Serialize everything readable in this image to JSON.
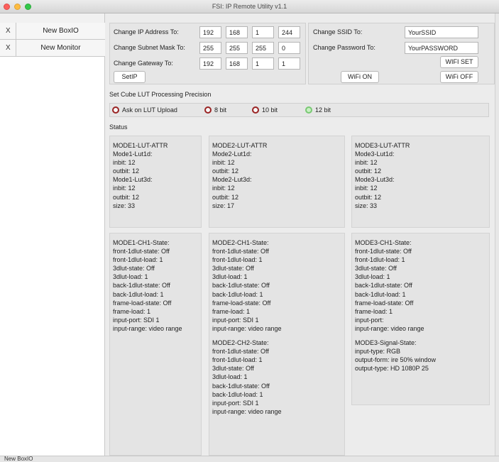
{
  "window": {
    "title": "FSI: IP Remote Utility v1.1"
  },
  "sidebar": {
    "items": [
      {
        "close": "X",
        "label": "New BoxIO"
      },
      {
        "close": "X",
        "label": "New Monitor"
      }
    ]
  },
  "network": {
    "ip_label": "Change IP Address To:",
    "ip": [
      "192",
      "168",
      "1",
      "244"
    ],
    "subnet_label": "Change Subnet Mask To:",
    "subnet": [
      "255",
      "255",
      "255",
      "0"
    ],
    "gateway_label": "Change Gateway To:",
    "gateway": [
      "192",
      "168",
      "1",
      "1"
    ],
    "setip_button": "SetIP"
  },
  "wifi": {
    "ssid_label": "Change SSID To:",
    "ssid_value": "YourSSID",
    "password_label": "Change Password To:",
    "password_value": "YourPASSWORD",
    "set_button": "WIFI SET",
    "on_button": "WiFi ON",
    "off_button": "WiFi OFF"
  },
  "lut_precision": {
    "heading": "Set Cube LUT Processing Precision",
    "options": [
      {
        "label": "Ask on LUT Upload",
        "selected": false
      },
      {
        "label": "8 bit",
        "selected": false
      },
      {
        "label": "10 bit",
        "selected": false
      },
      {
        "label": "12 bit",
        "selected": true
      }
    ]
  },
  "status": {
    "heading": "Status",
    "lut_attr": [
      [
        "MODE1-LUT-ATTR",
        "Mode1-Lut1d:",
        "inbit: 12",
        "outbit: 12",
        "Mode1-Lut3d:",
        "inbit: 12",
        "outbit: 12",
        "size: 33"
      ],
      [
        "MODE2-LUT-ATTR",
        "Mode2-Lut1d:",
        "inbit: 12",
        "outbit: 12",
        "Mode2-Lut3d:",
        "inbit: 12",
        "outbit: 12",
        "size: 17"
      ],
      [
        "MODE3-LUT-ATTR",
        "Mode3-Lut1d:",
        "inbit: 12",
        "outbit: 12",
        "Mode3-Lut3d:",
        "inbit: 12",
        "outbit: 12",
        "size: 33"
      ]
    ],
    "mode1_ch1": [
      "MODE1-CH1-State:",
      "front-1dlut-state: Off",
      "front-1dlut-load: 1",
      "3dlut-state: Off",
      "3dlut-load: 1",
      "back-1dlut-state: Off",
      "back-1dlut-load: 1",
      "frame-load-state: Off",
      "frame-load: 1",
      "input-port: SDI 1",
      "input-range: video range"
    ],
    "mode2_ch1": [
      "MODE2-CH1-State:",
      "front-1dlut-state: Off",
      "front-1dlut-load: 1",
      "3dlut-state: Off",
      "3dlut-load: 1",
      "back-1dlut-state: Off",
      "back-1dlut-load: 1",
      "frame-load-state: Off",
      "frame-load: 1",
      "input-port: SDI 1",
      "input-range: video range"
    ],
    "mode2_ch2": [
      "MODE2-CH2-State:",
      "front-1dlut-state: Off",
      "front-1dlut-load: 1",
      "3dlut-state: Off",
      "3dlut-load: 1",
      "back-1dlut-state: Off",
      "back-1dlut-load: 1",
      "input-port: SDI 1",
      "input-range: video range"
    ],
    "mode3_ch1": [
      "MODE3-CH1-State:",
      "front-1dlut-state: Off",
      "front-1dlut-load: 1",
      "3dlut-state: Off",
      "3dlut-load: 1",
      "back-1dlut-state: Off",
      "back-1dlut-load: 1",
      "frame-load-state: Off",
      "frame-load: 1",
      "input-port:",
      "input-range: video range"
    ],
    "mode3_signal": [
      "MODE3-Signal-State:",
      "input-type: RGB",
      "output-form: ire 50% window",
      "output-type: HD 1080P 25"
    ]
  },
  "statusbar": {
    "text": "New BoxIO"
  },
  "colors": {
    "radio_off": "#9a2323",
    "radio_on": "#79c873",
    "close": "#fc605c",
    "minimize": "#fdbc40",
    "maximize": "#34c84a"
  }
}
